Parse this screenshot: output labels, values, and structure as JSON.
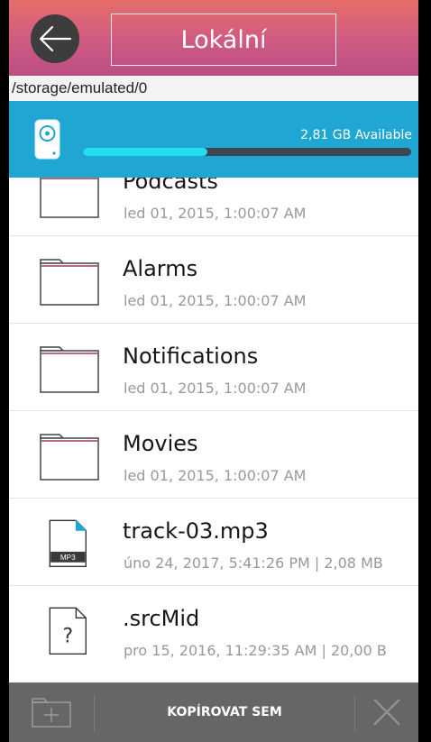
{
  "header": {
    "title": "Lokální",
    "back_icon": "arrow-left-icon"
  },
  "path": "/storage/emulated/0",
  "storage": {
    "icon": "storage-drive-icon",
    "available": "2,81 GB Available",
    "used_fraction": 0.38
  },
  "files": [
    {
      "name": "Podcasts",
      "meta": "led 01, 2015, 1:00:07 AM",
      "icon": "folder-icon"
    },
    {
      "name": "Alarms",
      "meta": "led 01, 2015, 1:00:07 AM",
      "icon": "folder-icon"
    },
    {
      "name": "Notifications",
      "meta": "led 01, 2015, 1:00:07 AM",
      "icon": "folder-icon"
    },
    {
      "name": "Movies",
      "meta": "led 01, 2015, 1:00:07 AM",
      "icon": "folder-icon"
    },
    {
      "name": "track-03.mp3",
      "meta": "úno 24, 2017, 5:41:26 PM | 2,08 MB",
      "icon": "mp3-file-icon",
      "badge": "MP3"
    },
    {
      "name": ".srcMid",
      "meta": "pro 15, 2016, 11:29:35 AM | 20,00 B",
      "icon": "unknown-file-icon",
      "badge": "?"
    }
  ],
  "bottom_bar": {
    "new_folder_icon": "new-folder-icon",
    "copy_label": "KOPÍROVAT SEM",
    "cancel_icon": "close-icon"
  },
  "colors": {
    "header_top": "#e66f6a",
    "header_bottom": "#bb4f85",
    "storage_bg": "#1fa6d3",
    "progress_fill": "#22ddec",
    "bottom_bar_bg": "#666666"
  }
}
